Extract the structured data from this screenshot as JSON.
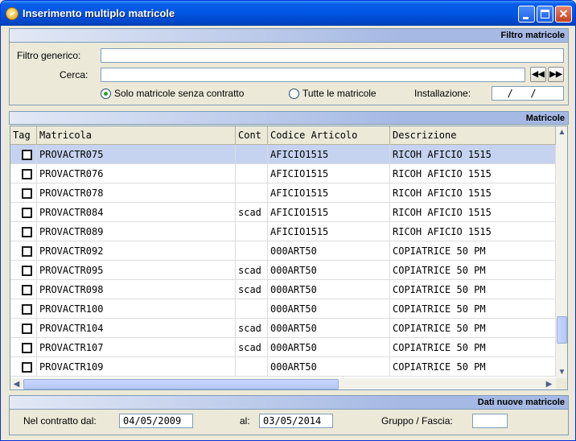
{
  "window": {
    "title": "Inserimento multiplo matricole",
    "controls": {
      "minimize": "",
      "maximize": "",
      "close": "✕"
    }
  },
  "filtro": {
    "header": "Filtro matricole",
    "generico_label": "Filtro generico:",
    "generico_value": "",
    "cerca_label": "Cerca:",
    "cerca_value": "",
    "nav_prev": "◀◀",
    "nav_next": "▶▶",
    "radio_senza_contratto": "Solo matricole senza contratto",
    "radio_tutte": "Tutte le matricole",
    "radio_selected": "senza_contratto",
    "installazione_label": "Installazione:",
    "installazione_value": "  /   /"
  },
  "matricole": {
    "header": "Matricole",
    "columns": [
      "Tag",
      "Matricola",
      "Cont",
      "Codice Articolo",
      "Descrizione"
    ],
    "rows": [
      {
        "matricola": "PROVACTR075",
        "cont": "",
        "codice": "AFICIO1515",
        "descrizione": "RICOH AFICIO 1515",
        "checked": false,
        "selected": true
      },
      {
        "matricola": "PROVACTR076",
        "cont": "",
        "codice": "AFICIO1515",
        "descrizione": "RICOH AFICIO 1515",
        "checked": false,
        "selected": false
      },
      {
        "matricola": "PROVACTR078",
        "cont": "",
        "codice": "AFICIO1515",
        "descrizione": "RICOH AFICIO 1515",
        "checked": false,
        "selected": false
      },
      {
        "matricola": "PROVACTR084",
        "cont": "scad",
        "codice": "AFICIO1515",
        "descrizione": "RICOH AFICIO 1515",
        "checked": false,
        "selected": false
      },
      {
        "matricola": "PROVACTR089",
        "cont": "",
        "codice": "AFICIO1515",
        "descrizione": "RICOH AFICIO 1515",
        "checked": false,
        "selected": false
      },
      {
        "matricola": "PROVACTR092",
        "cont": "",
        "codice": "000ART50",
        "descrizione": "COPIATRICE 50 PM",
        "checked": false,
        "selected": false
      },
      {
        "matricola": "PROVACTR095",
        "cont": "scad",
        "codice": "000ART50",
        "descrizione": "COPIATRICE 50 PM",
        "checked": false,
        "selected": false
      },
      {
        "matricola": "PROVACTR098",
        "cont": "scad",
        "codice": "000ART50",
        "descrizione": "COPIATRICE 50 PM",
        "checked": false,
        "selected": false
      },
      {
        "matricola": "PROVACTR100",
        "cont": "",
        "codice": "000ART50",
        "descrizione": "COPIATRICE 50 PM",
        "checked": false,
        "selected": false
      },
      {
        "matricola": "PROVACTR104",
        "cont": "scad",
        "codice": "000ART50",
        "descrizione": "COPIATRICE 50 PM",
        "checked": false,
        "selected": false
      },
      {
        "matricola": "PROVACTR107",
        "cont": "scad",
        "codice": "000ART50",
        "descrizione": "COPIATRICE 50 PM",
        "checked": false,
        "selected": false
      },
      {
        "matricola": "PROVACTR109",
        "cont": "",
        "codice": "000ART50",
        "descrizione": "COPIATRICE 50 PM",
        "checked": false,
        "selected": false
      }
    ],
    "scroll": {
      "up": "▲",
      "down": "▼",
      "left": "◀",
      "right": "▶"
    }
  },
  "dati": {
    "header": "Dati nuove matricole",
    "contratto_dal_label": "Nel contratto dal:",
    "contratto_dal_value": "04/05/2009",
    "al_label": "al:",
    "al_value": "03/05/2014",
    "gruppo_label": "Gruppo / Fascia:",
    "gruppo_value": ""
  },
  "colors": {
    "title_blue": "#0054e3",
    "selection": "#c5d3f0",
    "section_header": "#a6b9e4"
  }
}
